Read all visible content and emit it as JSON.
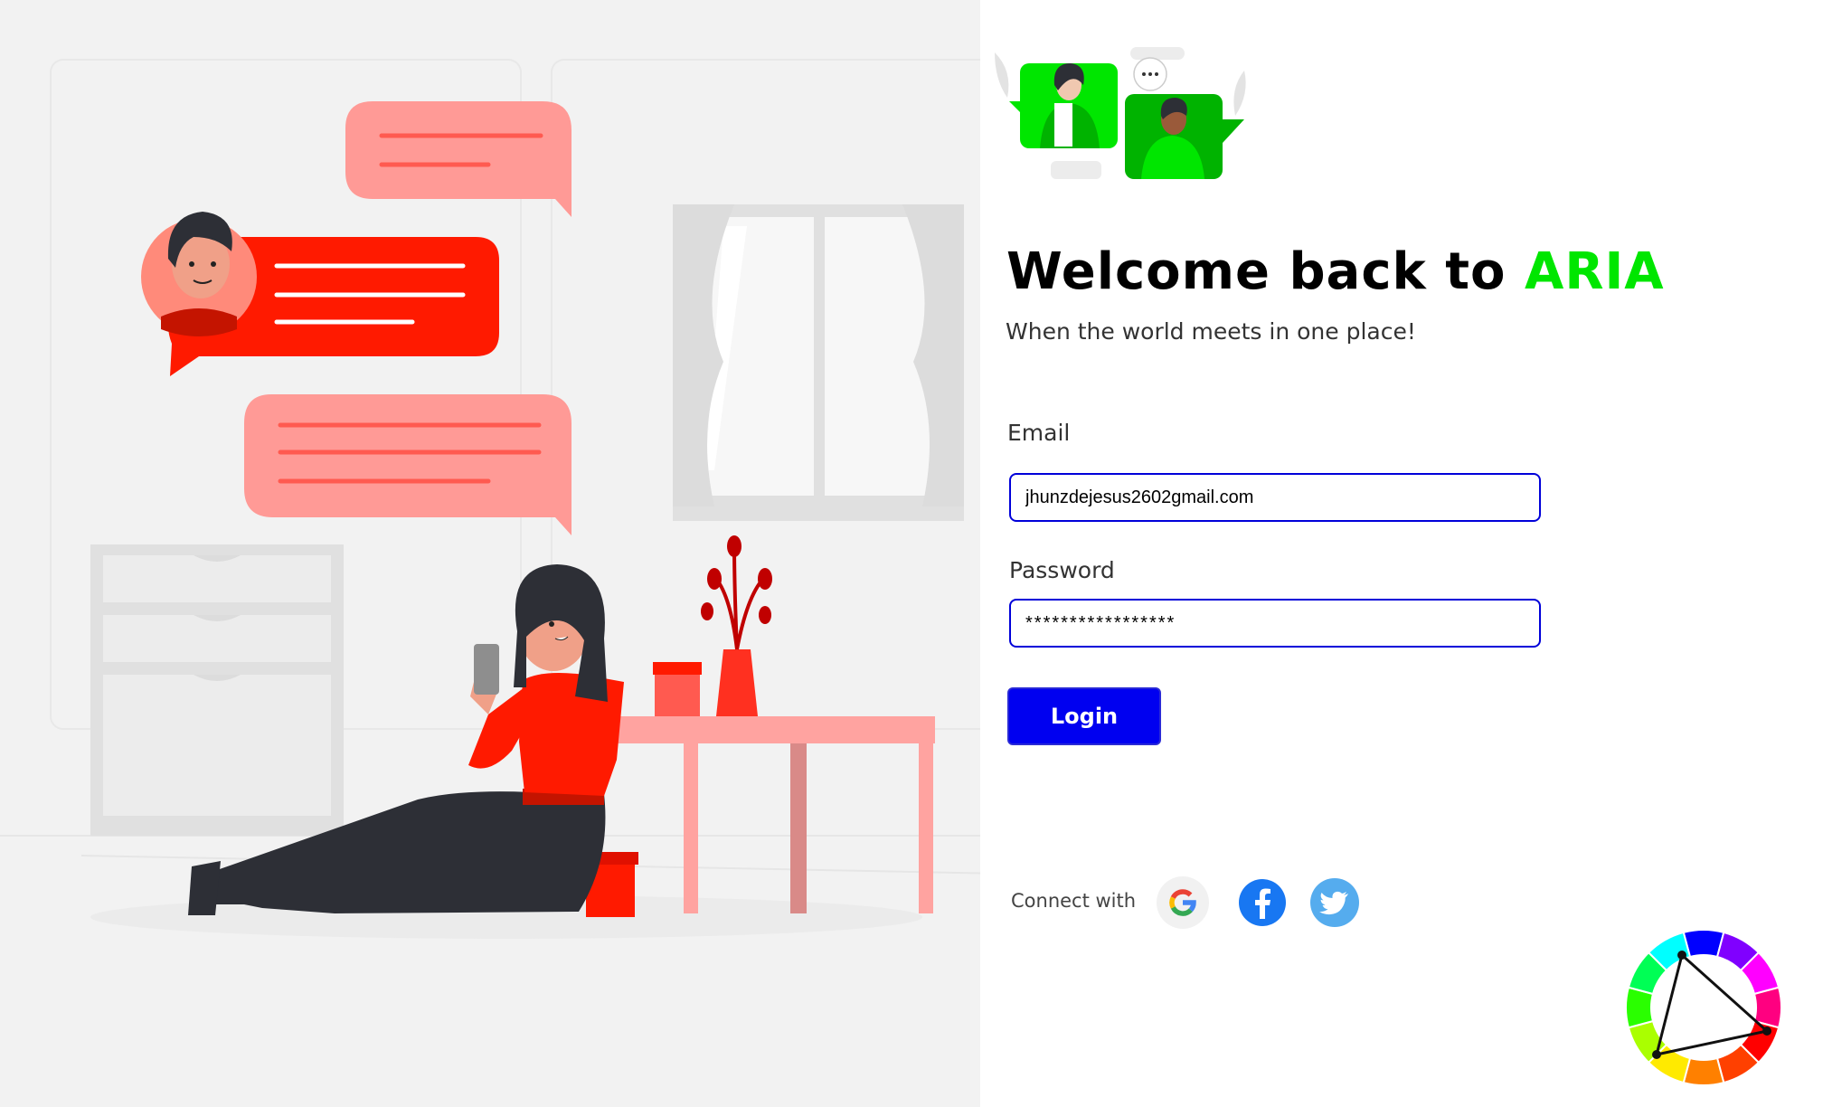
{
  "header": {
    "welcome_prefix": "Welcome back to ",
    "brand_name": "ARIA",
    "tagline": "When the world meets in one place!"
  },
  "form": {
    "email_label": "Email",
    "email_value": "jhunzdejesus2602gmail.com",
    "password_label": "Password",
    "password_value": "*****************",
    "login_label": "Login"
  },
  "social": {
    "connect_label": "Connect with",
    "providers": [
      "google-icon",
      "facebook-icon",
      "twitter-icon"
    ]
  },
  "colors": {
    "brand_green": "#00e600",
    "primary_blue": "#0000f0",
    "accent_red": "#ff1a00",
    "facebook_blue": "#1877f2",
    "twitter_blue": "#55acee"
  }
}
